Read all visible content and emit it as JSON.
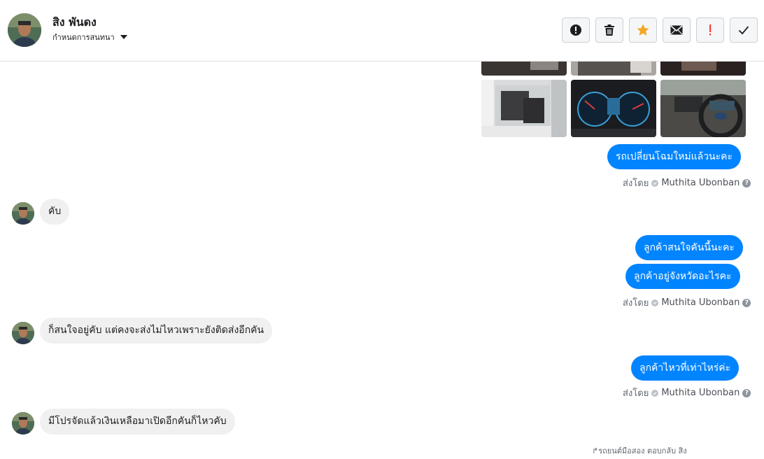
{
  "header": {
    "contact_name": "สิง พันดง",
    "assign_label": "กำหนดการสนทนา",
    "avatar_icon": "person-avatar",
    "actions": [
      {
        "name": "mark-spam-button",
        "icon": "alert-circle-icon"
      },
      {
        "name": "delete-button",
        "icon": "trash-icon"
      },
      {
        "name": "star-button",
        "icon": "star-icon"
      },
      {
        "name": "mark-unread-button",
        "icon": "envelope-icon"
      },
      {
        "name": "priority-button",
        "icon": "exclamation-icon"
      },
      {
        "name": "mark-done-button",
        "icon": "check-icon"
      }
    ]
  },
  "colors": {
    "outgoing_bubble": "#0084ff",
    "incoming_bubble": "#f1f0f0",
    "star": "#f5a623",
    "priority": "#fa3e3e"
  },
  "messages": {
    "m1": "รถเปลี่ยนโฉมใหม่แล้วนะคะ",
    "m2": "คับ",
    "m3": "ลูกค้าสนใจคันนี้นะคะ",
    "m4": "ลูกค้าอยู่จังหวัดอะไรคะ",
    "m5": "ก็สนใจอยู่คับ แต่คงจะส่งไม่ไหวเพราะยังติดส่งอีกคัน",
    "m6": "ลูกค้าไหวที่เท่าไหร่ค่ะ",
    "m7": "มีโปรจัดแล้วเงินเหลือมาเปิดอีกคันก็ไหวคับ"
  },
  "sent_by": {
    "prefix": "ส่งโดย",
    "agent": "Muthita Ubonban",
    "help": "?"
  },
  "footer_note": "รถยนต์มือสอง ตอบกลับ สิง"
}
